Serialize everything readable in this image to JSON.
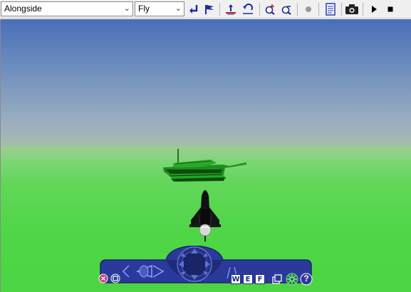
{
  "toolbar": {
    "viewpoint_value": "Alongside",
    "navigation_mode_value": "Fly",
    "icons": [
      "return-icon",
      "flag-icon",
      "straighten-icon",
      "undo-move-icon",
      "zoom-in-icon",
      "zoom-out-icon",
      "record-dot-icon",
      "viewpoints-list-icon",
      "snapshot-icon",
      "play-icon",
      "stop-icon"
    ]
  },
  "navigator": {
    "letters": [
      "W",
      "E",
      "F"
    ],
    "help_label": "?",
    "colors": {
      "panel": "#2b3a9a",
      "panel_dark": "#1a2466",
      "accent": "#7f8fe0"
    }
  },
  "scene": {
    "colors": {
      "sky_top": "#4a6eb8",
      "sky_horizon": "#a8b6b8",
      "ground": "#4bd543",
      "tank": "#1f8f1f",
      "tank_dark": "#0f5a0f",
      "jet": "#111111"
    }
  }
}
